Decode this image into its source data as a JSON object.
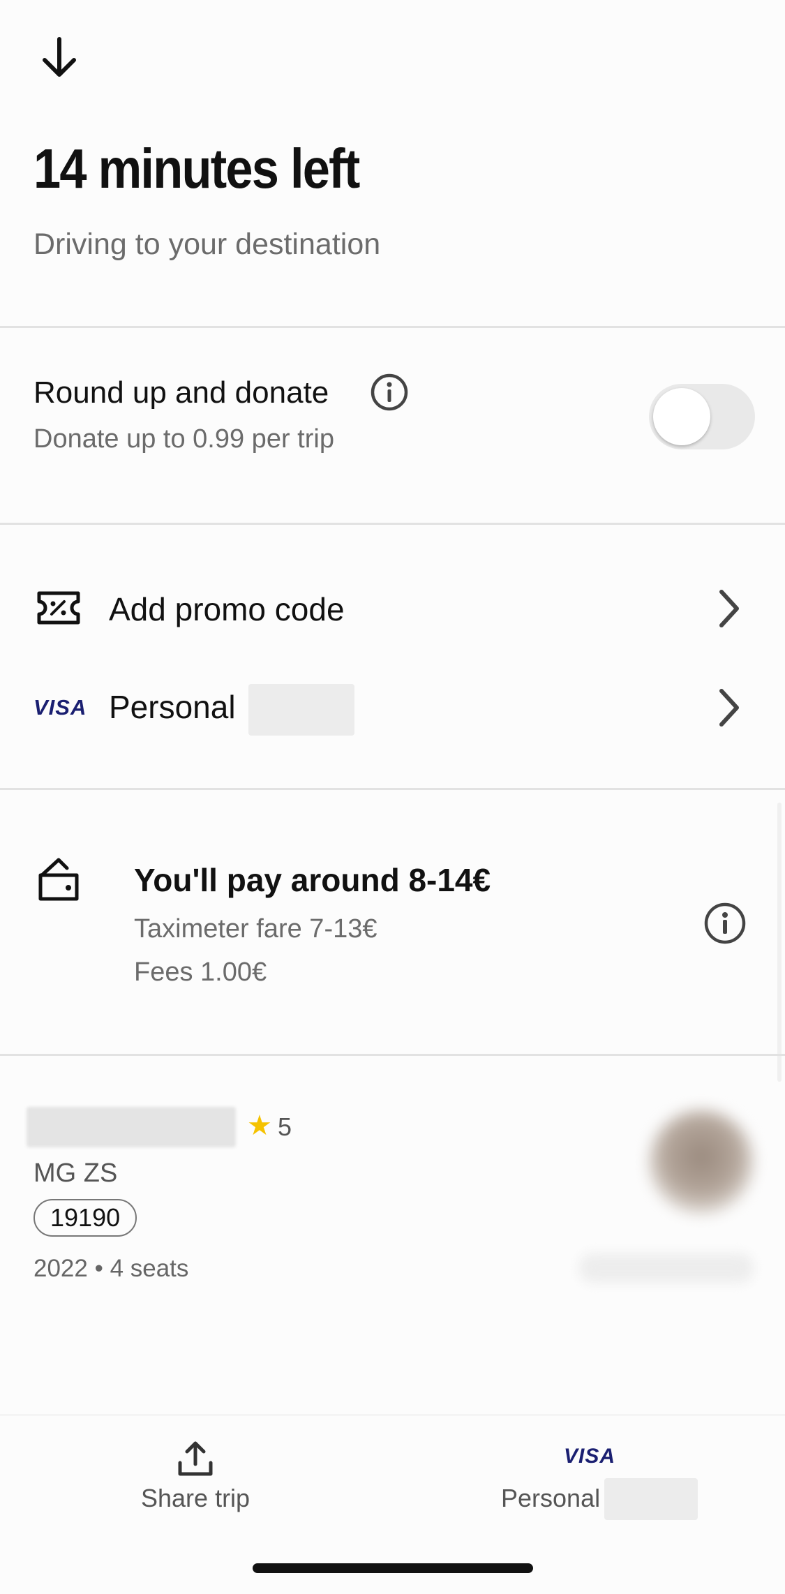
{
  "header": {
    "back_icon": "arrow-down-icon",
    "title": "14 minutes left",
    "subtitle": "Driving to your destination"
  },
  "donate": {
    "title": "Round up and donate",
    "subtitle": "Donate up to 0.99 per trip",
    "info_icon": "info-icon",
    "toggle_on": false
  },
  "payment": {
    "promo_label": "Add promo code",
    "promo_icon": "ticket-percent-icon",
    "card_brand": "VISA",
    "card_label": "Personal",
    "chevron_icon": "chevron-right-icon"
  },
  "fare": {
    "wallet_icon": "wallet-icon",
    "title": "You'll pay around 8-14€",
    "taximeter": "Taximeter fare 7-13€",
    "fees": "Fees 1.00€",
    "info_icon": "info-icon"
  },
  "driver": {
    "rating_star": "★",
    "rating": "5",
    "car_model": "MG ZS",
    "plate": "19190",
    "car_info": "2022 • 4 seats"
  },
  "bottom_bar": {
    "share_icon": "share-upload-icon",
    "share_label": "Share trip",
    "card_brand": "VISA",
    "card_label": "Personal"
  },
  "colors": {
    "visa_blue": "#1a1f71",
    "star_yellow": "#f5c200",
    "secondary_text": "#6b6b6b"
  }
}
